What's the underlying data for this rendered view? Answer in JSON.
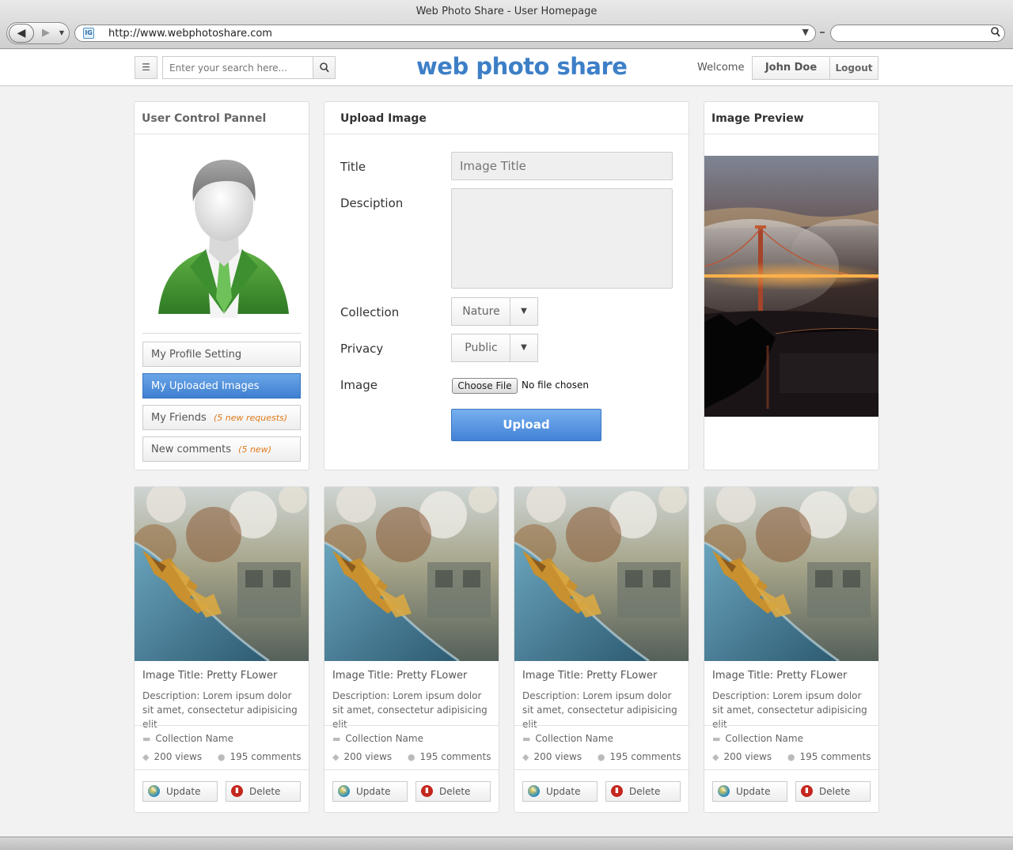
{
  "browser": {
    "window_title": "Web Photo Share - User Homepage",
    "url": "http://www.webphotoshare.com",
    "favicon_label": "IG"
  },
  "header": {
    "search_placeholder": "Enter your search here...",
    "brand": "web photo share",
    "welcome": "Welcome",
    "user_name": "John Doe",
    "logout": "Logout"
  },
  "control_panel": {
    "title": "User Control Pannel",
    "items": [
      {
        "label": "My Profile Setting",
        "note": ""
      },
      {
        "label": "My Uploaded Images",
        "note": ""
      },
      {
        "label": "My Friends",
        "note": "(5 new requests)"
      },
      {
        "label": "New comments",
        "note": "(5 new)"
      }
    ]
  },
  "upload_form": {
    "title": "Upload Image",
    "labels": {
      "title": "Title",
      "description": "Desciption",
      "collection": "Collection",
      "privacy": "Privacy",
      "image": "Image"
    },
    "title_placeholder": "Image Title",
    "collection_value": "Nature",
    "privacy_value": "Public",
    "choose_file": "Choose File",
    "no_file": "No file chosen",
    "upload_button": "Upload"
  },
  "preview": {
    "title": "Image Preview"
  },
  "cards": [
    {
      "title": "Image Title: Pretty FLower",
      "description": "Description: Lorem ipsum dolor sit amet, consectetur adipisicing elit",
      "collection": "Collection Name",
      "views": "200 views",
      "comments": "195 comments",
      "update": "Update",
      "delete": "Delete"
    },
    {
      "title": "Image Title: Pretty FLower",
      "description": "Description: Lorem ipsum dolor sit amet, consectetur adipisicing elit",
      "collection": "Collection Name",
      "views": "200 views",
      "comments": "195 comments",
      "update": "Update",
      "delete": "Delete"
    },
    {
      "title": "Image Title: Pretty FLower",
      "description": "Description: Lorem ipsum dolor sit amet, consectetur adipisicing elit",
      "collection": "Collection Name",
      "views": "200 views",
      "comments": "195 comments",
      "update": "Update",
      "delete": "Delete"
    },
    {
      "title": "Image Title: Pretty FLower",
      "description": "Description: Lorem ipsum dolor sit amet, consectetur adipisicing elit",
      "collection": "Collection Name",
      "views": "200 views",
      "comments": "195 comments",
      "update": "Update",
      "delete": "Delete"
    }
  ],
  "colors": {
    "accent_blue": "#3d7fc7",
    "active_button": "#4a8ad8",
    "note_orange": "#e07a1a",
    "delete_red": "#c4261d"
  }
}
